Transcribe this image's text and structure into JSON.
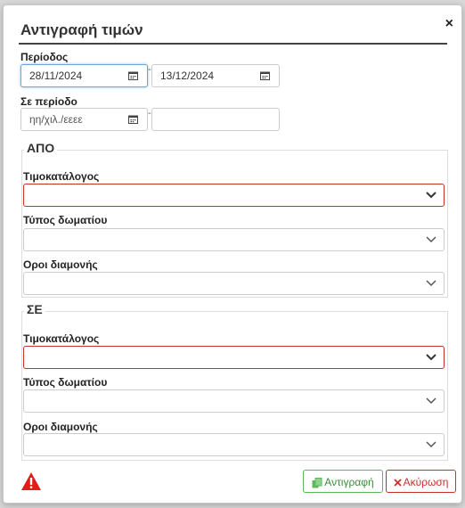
{
  "dialog": {
    "title": "Αντιγραφή τιμών",
    "close_symbol": "×"
  },
  "period": {
    "label": "Περίοδος",
    "from_value": "28/11/2024",
    "to_value": "13/12/2024",
    "separator": "-"
  },
  "target_period": {
    "label": "Σε περίοδο",
    "from_placeholder": "ηη/χιλ./εεεε",
    "to_value": "",
    "separator": "-"
  },
  "from_section": {
    "legend": "ΑΠΟ",
    "pricelist_label": "Τιμοκατάλογος",
    "pricelist_value": "",
    "room_type_label": "Τύπος δωματίου",
    "room_type_value": "",
    "stay_terms_label": "Οροι διαμονής",
    "stay_terms_value": ""
  },
  "to_section": {
    "legend": "ΣΕ",
    "pricelist_label": "Τιμοκατάλογος",
    "pricelist_value": "",
    "room_type_label": "Τύπος δωματίου",
    "room_type_value": "",
    "stay_terms_label": "Οροι διαμονής",
    "stay_terms_value": ""
  },
  "footer": {
    "copy_label": "Αντιγραφή",
    "cancel_label": "Ακύρωση",
    "warning_icon": "warning-triangle-icon"
  },
  "colors": {
    "error": "#c9302c",
    "success": "#5cb85c",
    "focus": "#6fa3d9"
  }
}
